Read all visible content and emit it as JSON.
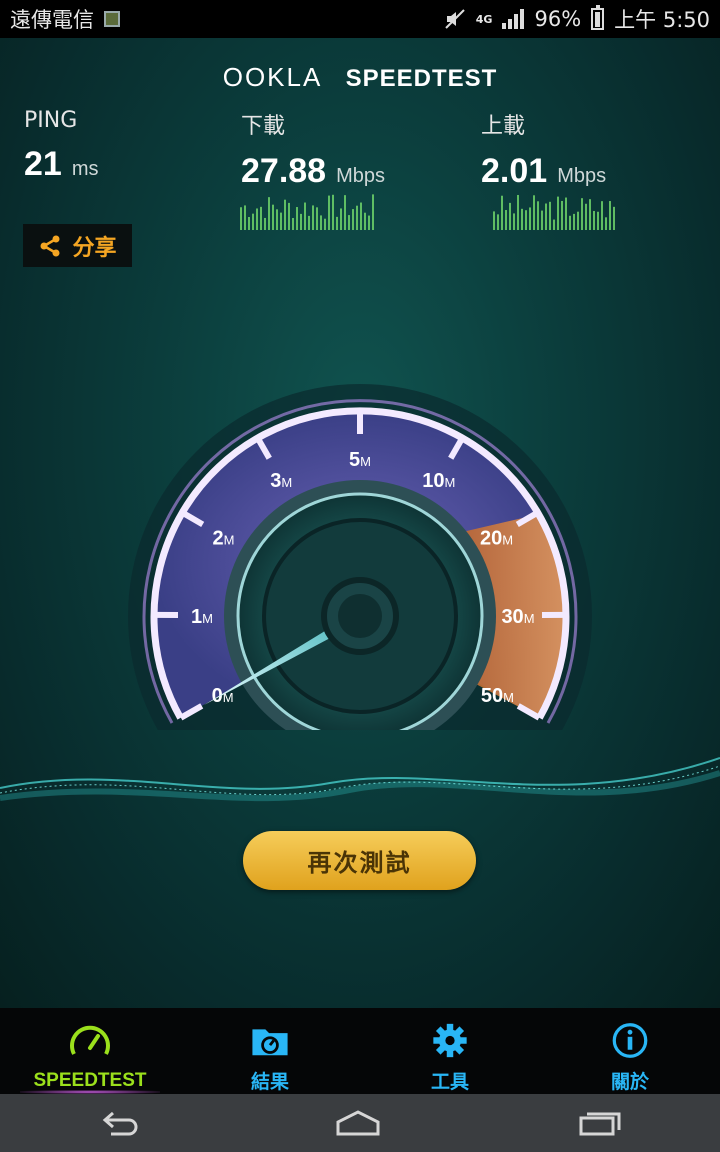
{
  "status_bar": {
    "carrier": "遠傳電信",
    "network": "4G",
    "battery": "96%",
    "time": "上午 5:50"
  },
  "header": {
    "logo_ookla": "OOKLA",
    "logo_speedtest": "SPEEDTEST"
  },
  "metrics": {
    "ping": {
      "label": "PING",
      "value": "21",
      "unit": "ms"
    },
    "download": {
      "label": "下載",
      "value": "27.88",
      "unit": "Mbps"
    },
    "upload": {
      "label": "上載",
      "value": "2.01",
      "unit": "Mbps"
    }
  },
  "share": {
    "label": "分享",
    "icon": "share-icon"
  },
  "gauge": {
    "ticks": [
      "0",
      "1",
      "2",
      "3",
      "5",
      "10",
      "20",
      "30",
      "50"
    ],
    "tick_unit": "M",
    "needle_value": 0.3,
    "needle_value_note": "needle rests near the low end of the scale",
    "colors": {
      "arc": "#b98ff0",
      "high_band": "#f0a05a",
      "needle": "#7fe3ea"
    }
  },
  "actions": {
    "retest_label": "再次測試"
  },
  "tabs": [
    {
      "label": "SPEEDTEST",
      "icon": "speedometer-icon",
      "active": true
    },
    {
      "label": "結果",
      "icon": "results-folder-icon",
      "active": false
    },
    {
      "label": "工具",
      "icon": "gear-icon",
      "active": false
    },
    {
      "label": "關於",
      "icon": "info-icon",
      "active": false
    }
  ],
  "nav": {
    "icons": [
      "back-icon",
      "home-icon",
      "recents-icon"
    ]
  }
}
